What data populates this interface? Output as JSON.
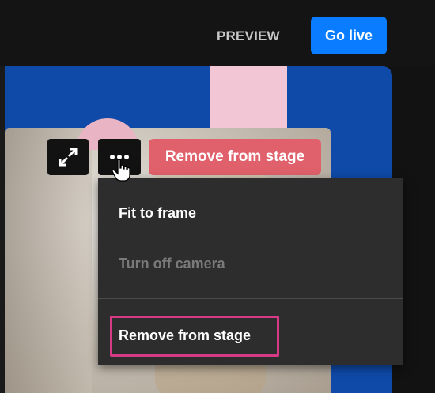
{
  "header": {
    "preview_label": "PREVIEW",
    "go_live_label": "Go live"
  },
  "tile_controls": {
    "expand_icon": "expand-arrows-icon",
    "more_icon": "more-options-icon",
    "remove_label": "Remove from stage"
  },
  "menu": {
    "items": [
      {
        "label": "Fit to frame",
        "enabled": true
      },
      {
        "label": "Turn off camera",
        "enabled": false
      },
      {
        "label": "Remove from stage",
        "enabled": true,
        "highlighted": true
      }
    ]
  },
  "colors": {
    "accent_blue": "#0a7cff",
    "remove_red": "#e0606b",
    "highlight_pink": "#d63a87"
  }
}
